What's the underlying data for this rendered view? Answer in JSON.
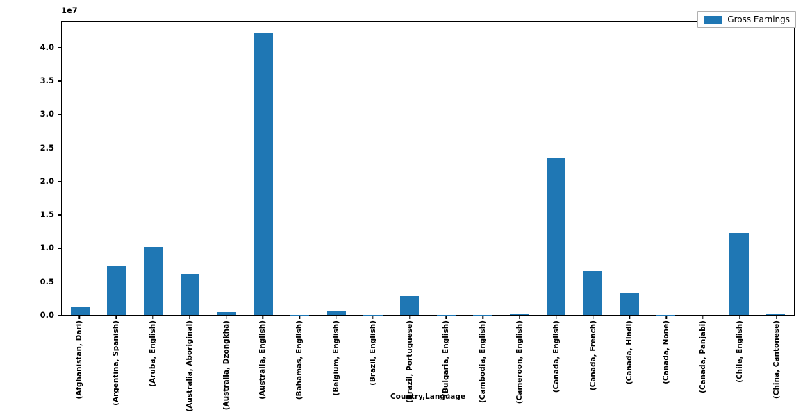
{
  "chart_data": {
    "type": "bar",
    "title": "",
    "xlabel": "Country,Language",
    "ylabel": "",
    "y_offset_text": "1e7",
    "y_offset_multiplier": 10000000,
    "ylim": [
      0,
      44000000
    ],
    "grid": false,
    "legend_position": "upper right",
    "bar_color": "#1f77b4",
    "series": [
      {
        "name": "Gross Earnings",
        "values": [
          1150000,
          7300000,
          10100000,
          6150000,
          420000,
          42000000,
          20000,
          650000,
          30000,
          2750000,
          15000,
          10000,
          90000,
          23400000,
          6600000,
          3300000,
          12000,
          8000,
          12250000,
          150000
        ]
      }
    ],
    "categories": [
      "(Afghanistan, Dari)",
      "(Argentina, Spanish)",
      "(Aruba, English)",
      "(Australia, Aboriginal)",
      "(Australia, Dzongkha)",
      "(Australia, English)",
      "(Bahamas, English)",
      "(Belgium, English)",
      "(Brazil, English)",
      "(Brazil, Portuguese)",
      "(Bulgaria, English)",
      "(Cambodia, English)",
      "(Cameroon, English)",
      "(Canada, English)",
      "(Canada, French)",
      "(Canada, Hindi)",
      "(Canada, None)",
      "(Canada, Panjabi)",
      "(Chile, English)",
      "(China, Cantonese)"
    ],
    "ytick_labels": [
      "0.0",
      "0.5",
      "1.0",
      "1.5",
      "2.0",
      "2.5",
      "3.0",
      "3.5",
      "4.0"
    ],
    "ytick_values": [
      0,
      5000000,
      10000000,
      15000000,
      20000000,
      25000000,
      30000000,
      35000000,
      40000000
    ]
  },
  "legend": {
    "label": "Gross Earnings"
  }
}
